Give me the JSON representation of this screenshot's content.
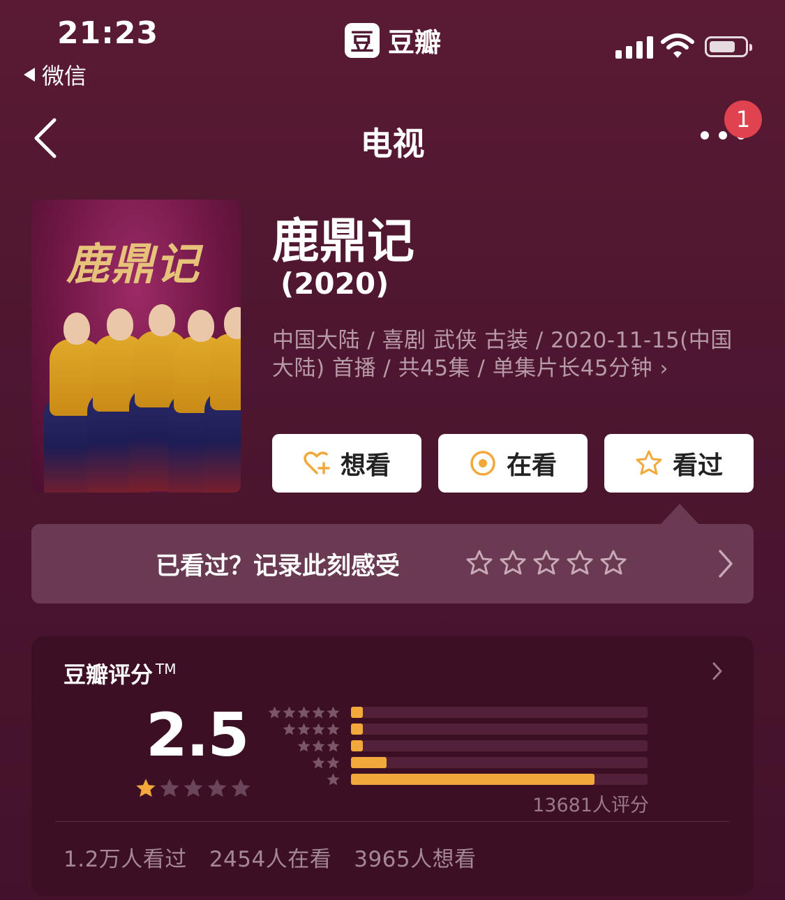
{
  "status_bar": {
    "time": "21:23",
    "back_app": "微信",
    "brand_logo": "豆",
    "brand_name": "豆瓣",
    "signal_bars": 4,
    "battery_level": 0.7
  },
  "nav": {
    "title": "电视",
    "notification_count": "1"
  },
  "item": {
    "poster_title": "鹿鼎记",
    "title": "鹿鼎记",
    "year": "(2020)",
    "meta": "中国大陆 / 喜剧 武侠 古装 / 2020-11-15(中国大陆) 首播 / 共45集 / 单集片长45分钟"
  },
  "actions": [
    {
      "label": "想看",
      "icon": "heart-plus-icon"
    },
    {
      "label": "在看",
      "icon": "watching-icon"
    },
    {
      "label": "看过",
      "icon": "star-outline-icon"
    }
  ],
  "prompt": {
    "text": "已看过？记录此刻感受",
    "star_count": 5
  },
  "rating": {
    "label": "豆瓣评分",
    "trademark": "TM",
    "score": "2.5",
    "score_stars_filled": 1,
    "distribution": [
      {
        "stars": 5,
        "fraction": 0.04
      },
      {
        "stars": 4,
        "fraction": 0.04
      },
      {
        "stars": 3,
        "fraction": 0.04
      },
      {
        "stars": 2,
        "fraction": 0.12
      },
      {
        "stars": 1,
        "fraction": 0.82
      }
    ],
    "total": "13681人评分",
    "counts": [
      "1.2万人看过",
      "2454人在看",
      "3965人想看"
    ]
  },
  "colors": {
    "background": "#4e1630",
    "accent": "#f3a83c",
    "badge": "#e0424f"
  }
}
